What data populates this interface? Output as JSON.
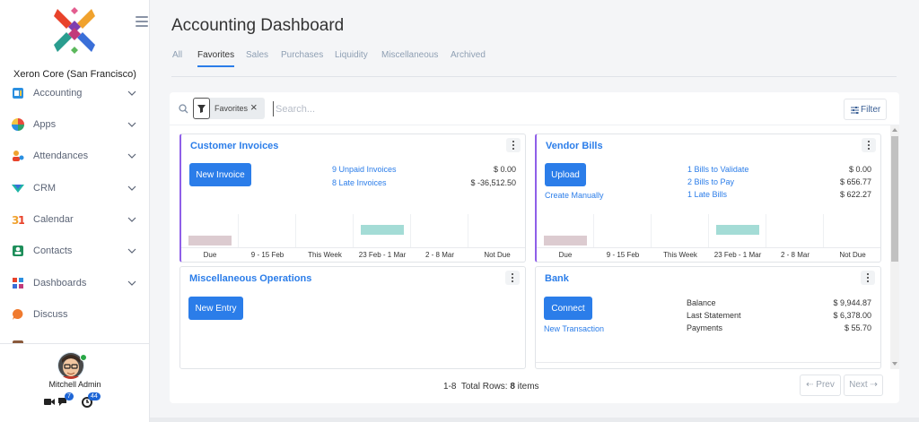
{
  "sidebar": {
    "company": "Xeron Core (San Francisco)",
    "items": [
      {
        "label": "Accounting",
        "icon": "accounting-icon",
        "has_children": true
      },
      {
        "label": "Apps",
        "icon": "apps-icon",
        "has_children": true
      },
      {
        "label": "Attendances",
        "icon": "attendances-icon",
        "has_children": true
      },
      {
        "label": "CRM",
        "icon": "crm-icon",
        "has_children": true
      },
      {
        "label": "Calendar",
        "icon": "calendar-icon",
        "has_children": true
      },
      {
        "label": "Contacts",
        "icon": "contacts-icon",
        "has_children": true
      },
      {
        "label": "Dashboards",
        "icon": "dashboards-icon",
        "has_children": true
      },
      {
        "label": "Discuss",
        "icon": "discuss-icon",
        "has_children": false
      }
    ],
    "user": {
      "name": "Mitchell Admin"
    },
    "badges": {
      "messages": "7",
      "activities": "44"
    }
  },
  "header": {
    "title": "Accounting Dashboard",
    "tabs": [
      {
        "label": "All",
        "active": false
      },
      {
        "label": "Favorites",
        "active": true
      },
      {
        "label": "Sales",
        "active": false
      },
      {
        "label": "Purchases",
        "active": false
      },
      {
        "label": "Liquidity",
        "active": false
      },
      {
        "label": "Miscellaneous",
        "active": false
      },
      {
        "label": "Archived",
        "active": false
      }
    ]
  },
  "search": {
    "facet": "Favorites",
    "placeholder": "Search...",
    "filter_label": "Filter"
  },
  "cards": {
    "customer_invoices": {
      "title": "Customer Invoices",
      "button": "New Invoice",
      "rows": [
        {
          "label": "9 Unpaid Invoices",
          "amount": "$ 0.00"
        },
        {
          "label": "8 Late Invoices",
          "amount": "$ -36,512.50"
        }
      ],
      "graph_labels": [
        "Due",
        "9 - 15 Feb",
        "This Week",
        "23 Feb - 1 Mar",
        "2 - 8 Mar",
        "Not Due"
      ],
      "graph_values": [
        0.3,
        0,
        0,
        0.3,
        0,
        0
      ]
    },
    "vendor_bills": {
      "title": "Vendor Bills",
      "button": "Upload",
      "secondary_link": "Create Manually",
      "rows": [
        {
          "label": "1 Bills to Validate",
          "amount": "$ 0.00"
        },
        {
          "label": "2 Bills to Pay",
          "amount": "$ 656.77"
        },
        {
          "label": "1 Late Bills",
          "amount": "$ 622.27"
        }
      ],
      "graph_labels": [
        "Due",
        "9 - 15 Feb",
        "This Week",
        "23 Feb - 1 Mar",
        "2 - 8 Mar",
        "Not Due"
      ],
      "graph_values": [
        0.3,
        0,
        0,
        0.3,
        0,
        0
      ]
    },
    "misc_operations": {
      "title": "Miscellaneous Operations",
      "button": "New Entry"
    },
    "bank": {
      "title": "Bank",
      "button": "Connect",
      "secondary_link": "New Transaction",
      "rows": [
        {
          "label": "Balance",
          "amount": "$ 9,944.87"
        },
        {
          "label": "Last Statement",
          "amount": "$ 6,378.00"
        },
        {
          "label": "Payments",
          "amount": "$ 55.70"
        }
      ]
    }
  },
  "pager": {
    "range": "1-8",
    "total_label": "Total Rows:",
    "total": "8",
    "unit": "items",
    "prev": "Prev",
    "next": "Next"
  },
  "colors": {
    "accent": "#2b7de9",
    "card_border_accent": "#8f5fe8",
    "bar_past": "#dccbd0",
    "bar_future": "#a4dcd6"
  }
}
